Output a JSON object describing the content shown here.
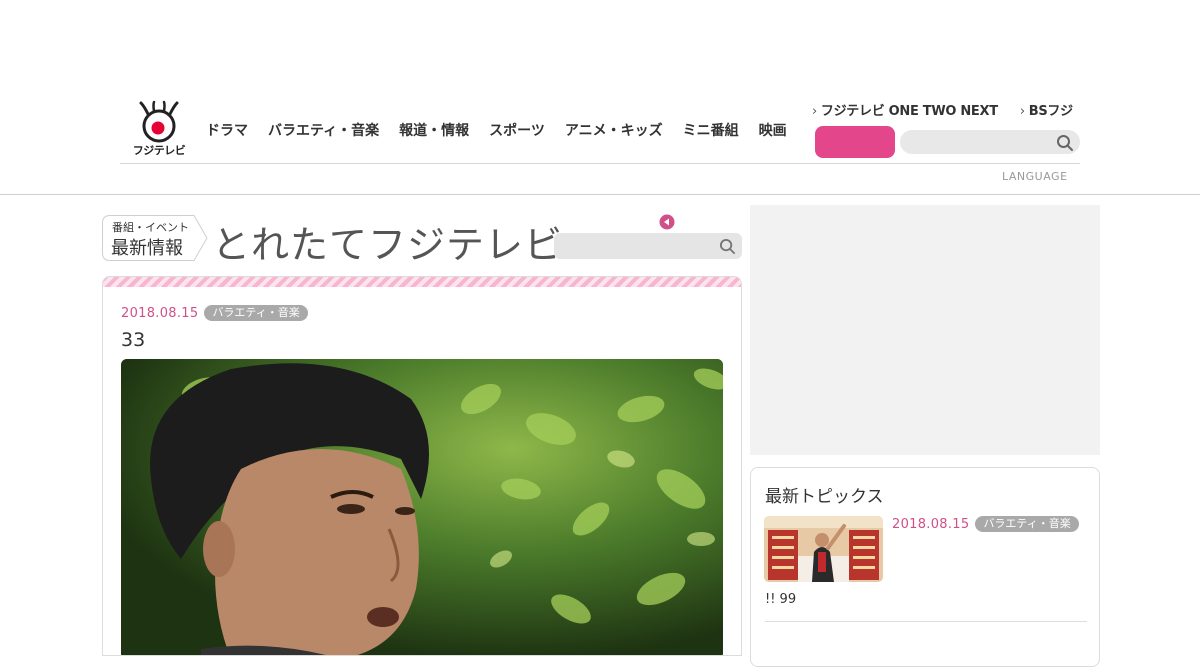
{
  "header": {
    "logo_text": "フジテレビ",
    "nav": [
      "ドラマ",
      "バラエティ・音楽",
      "報道・情報",
      "スポーツ",
      "アニメ・キッズ",
      "ミニ番組",
      "映画"
    ],
    "sublinks": [
      "フジテレビ ONE TWO NEXT",
      "BSフジ"
    ],
    "pink_button_label": "",
    "search_placeholder": "",
    "language_label": "LANGUAGE"
  },
  "section": {
    "badge_small": "番組・イベント",
    "badge_big": "最新情報",
    "title": "とれたてフジテレビ",
    "search_placeholder": ""
  },
  "article": {
    "date": "2018.08.15",
    "category": "バラエティ・音楽",
    "title": "33"
  },
  "sidebar": {
    "topics_heading": "最新トピックス",
    "topic": {
      "date": "2018.08.15",
      "category": "バラエティ・音楽",
      "text": "!! 99"
    }
  },
  "colors": {
    "accent_pink": "#e4468b",
    "date_pink": "#d0508a",
    "tag_gray": "#a9a9a9"
  },
  "icons": [
    "fuji-logo-icon",
    "chevron-right-icon",
    "search-icon",
    "play-left-icon"
  ]
}
